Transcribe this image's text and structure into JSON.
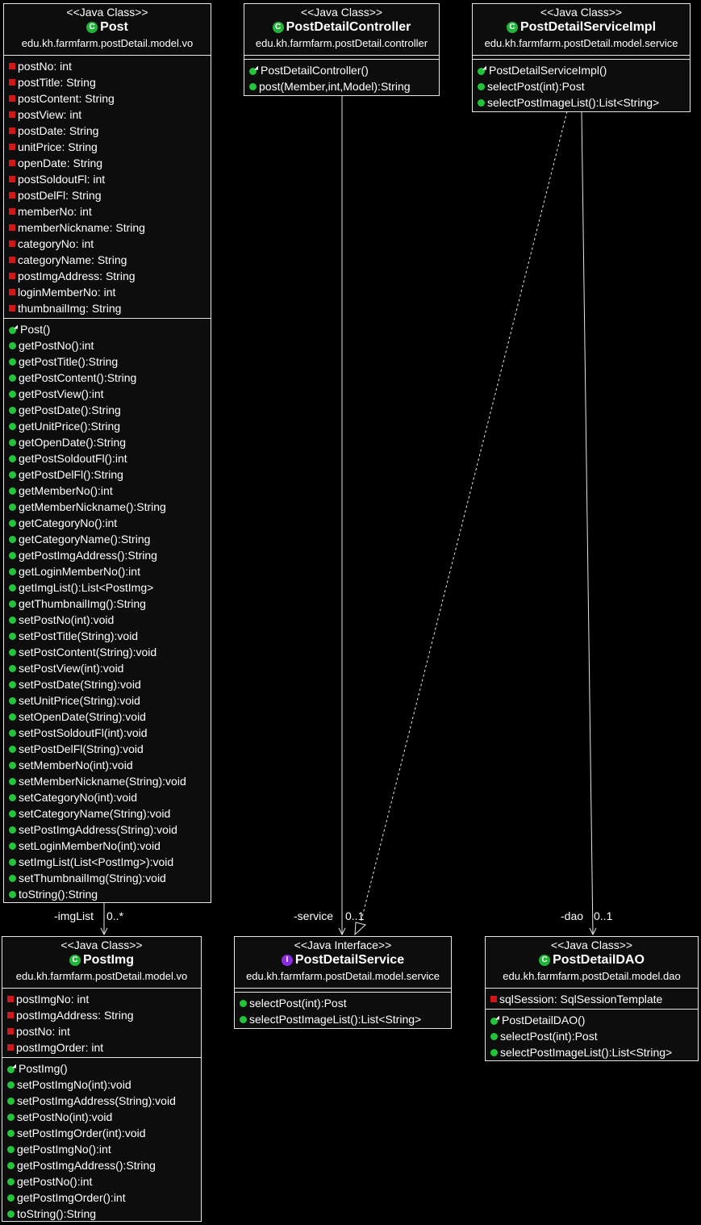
{
  "classes": {
    "post": {
      "stereotype": "<<Java Class>>",
      "badge": "C",
      "name": "Post",
      "package": "edu.kh.farmfarm.postDetail.model.vo",
      "fields": [
        "postNo: int",
        "postTitle: String",
        "postContent: String",
        "postView: int",
        "postDate: String",
        "unitPrice: String",
        "openDate: String",
        "postSoldoutFl: int",
        "postDelFl: String",
        "memberNo: int",
        "memberNickname: String",
        "categoryNo: int",
        "categoryName: String",
        "postImgAddress: String",
        "loginMemberNo: int",
        "thumbnailImg: String"
      ],
      "constructor": "Post()",
      "methods": [
        "getPostNo():int",
        "getPostTitle():String",
        "getPostContent():String",
        "getPostView():int",
        "getPostDate():String",
        "getUnitPrice():String",
        "getOpenDate():String",
        "getPostSoldoutFl():int",
        "getPostDelFl():String",
        "getMemberNo():int",
        "getMemberNickname():String",
        "getCategoryNo():int",
        "getCategoryName():String",
        "getPostImgAddress():String",
        "getLoginMemberNo():int",
        "getImgList():List<PostImg>",
        "getThumbnailImg():String",
        "setPostNo(int):void",
        "setPostTitle(String):void",
        "setPostContent(String):void",
        "setPostView(int):void",
        "setPostDate(String):void",
        "setUnitPrice(String):void",
        "setOpenDate(String):void",
        "setPostSoldoutFl(int):void",
        "setPostDelFl(String):void",
        "setMemberNo(int):void",
        "setMemberNickname(String):void",
        "setCategoryNo(int):void",
        "setCategoryName(String):void",
        "setPostImgAddress(String):void",
        "setLoginMemberNo(int):void",
        "setImgList(List<PostImg>):void",
        "setThumbnailImg(String):void",
        "toString():String"
      ]
    },
    "controller": {
      "stereotype": "<<Java Class>>",
      "badge": "C",
      "name": "PostDetailController",
      "package": "edu.kh.farmfarm.postDetail.controller",
      "constructor": "PostDetailController()",
      "methods": [
        "post(Member,int,Model):String"
      ]
    },
    "serviceImpl": {
      "stereotype": "<<Java Class>>",
      "badge": "C",
      "name": "PostDetailServiceImpl",
      "package": "edu.kh.farmfarm.postDetail.model.service",
      "constructor": "PostDetailServiceImpl()",
      "methods": [
        "selectPost(int):Post",
        "selectPostImageList():List<String>"
      ]
    },
    "postImg": {
      "stereotype": "<<Java Class>>",
      "badge": "C",
      "name": "PostImg",
      "package": "edu.kh.farmfarm.postDetail.model.vo",
      "fields": [
        "postImgNo: int",
        "postImgAddress: String",
        "postNo: int",
        "postImgOrder: int"
      ],
      "constructor": "PostImg()",
      "methods": [
        "setPostImgNo(int):void",
        "setPostImgAddress(String):void",
        "setPostNo(int):void",
        "setPostImgOrder(int):void",
        "getPostImgNo():int",
        "getPostImgAddress():String",
        "getPostNo():int",
        "getPostImgOrder():int",
        "toString():String"
      ]
    },
    "service": {
      "stereotype": "<<Java Interface>>",
      "badge": "I",
      "name": "PostDetailService",
      "package": "edu.kh.farmfarm.postDetail.model.service",
      "methods": [
        "selectPost(int):Post",
        "selectPostImageList():List<String>"
      ]
    },
    "dao": {
      "stereotype": "<<Java Class>>",
      "badge": "C",
      "name": "PostDetailDAO",
      "package": "edu.kh.farmfarm.postDetail.model.dao",
      "fields": [
        "sqlSession: SqlSessionTemplate"
      ],
      "constructor": "PostDetailDAO()",
      "methods": [
        "selectPost(int):Post",
        "selectPostImageList():List<String>"
      ]
    }
  },
  "associations": {
    "imgList_role": "-imgList",
    "imgList_mult": "0..*",
    "service_role": "-service",
    "service_mult": "0..1",
    "dao_role": "-dao",
    "dao_mult": "0..1"
  },
  "colors": {
    "background": "#000000",
    "box_fill": "#0d0d0d",
    "border": "#e6e6e6",
    "field_marker": "#d01818",
    "method_marker": "#22c43a",
    "interface_badge": "#8a2be2"
  }
}
